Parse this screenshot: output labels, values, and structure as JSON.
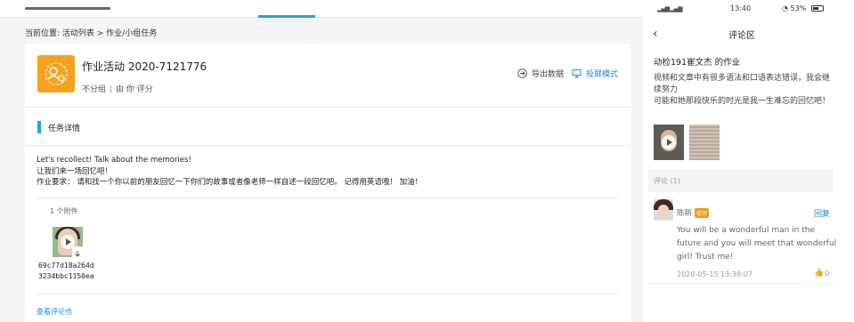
{
  "web": {
    "breadcrumb": "当前位置: 活动列表 > 作业/小组任务",
    "activity": {
      "title": "作业活动 2020-7121776",
      "group": "不分组",
      "rater": "由 你 评分",
      "export_label": "导出数据",
      "screen_label": "投屏模式"
    },
    "section_title": "任务详情",
    "content_lines": [
      "Let's recollect! Talk about the memories!",
      "让我们来一场回忆吧！",
      "作业要求： 请和找一个你以前的朋友回忆一下你们的故事或者像老师一样自述一段回忆吧。 记得用英语哦！ 加油！"
    ],
    "attachments_count": "1 个附件",
    "attachment_name_line1": "69c77d18a264d",
    "attachment_name_line2": "3234bbc1150ea",
    "view_comments": "查看评论也"
  },
  "phone": {
    "status": {
      "time": "13:40",
      "battery": "53%"
    },
    "nav_title": "评论区",
    "post": {
      "author": "动检191崔文杰 的作业",
      "body": [
        "视频和文章中有很多语法和口语表达错误，我会继续努力",
        "可能和她那段快乐的时光是我一生难忘的回忆吧！"
      ]
    },
    "comments_header": "评论 (1)",
    "comment": {
      "name": "陈新",
      "badge": "老师",
      "reply": "回复",
      "text": "You will be a wonderful man in the future and you will meet that wonderful girl! Trust me!",
      "time": "2020-05-15 13:38:07",
      "likes": "0"
    }
  },
  "colors": {
    "accent_blue": "#1fa3e0",
    "link_blue": "#1e88e5",
    "activity_icon": "#f6a21d",
    "teacher_badge": "#f39c12"
  }
}
